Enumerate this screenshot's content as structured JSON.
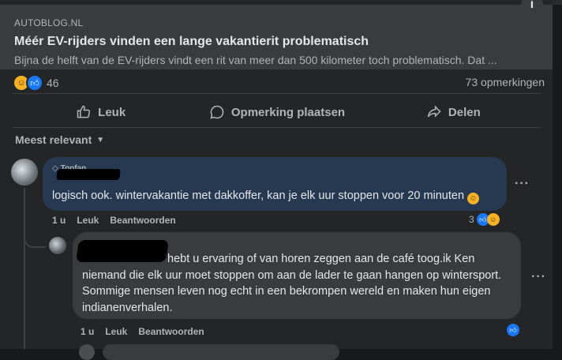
{
  "post": {
    "source": "AUTOBLOG.NL",
    "headline": "Méér EV-rijders vinden een lange vakantierit problematisch",
    "description": "Bijna de helft van de EV-rijders vindt een rit van meer dan 500 kilometer toch problematisch. Dat ...",
    "reaction_count": "46",
    "comments_count": "73 opmerkingen"
  },
  "actions": {
    "like": "Leuk",
    "comment": "Opmerking plaatsen",
    "share": "Delen"
  },
  "sort": {
    "label": "Meest relevant"
  },
  "comments": [
    {
      "badge": "Topfan",
      "text": "logisch ook. wintervakantie met dakkoffer, kan je elk uur stoppen voor 20 minuten",
      "time": "1 u",
      "like": "Leuk",
      "reply": "Beantwoorden",
      "reactions": "3"
    },
    {
      "text": "hebt u ervaring of van horen zeggen aan de café toog.ik Ken niemand die elk uur moet stoppen om aan de lader te gaan hangen op wintersport. Sommige mensen leven nog echt in een bekrompen wereld en maken hun eigen indianenverhalen.",
      "time": "1 u",
      "like": "Leuk",
      "reply": "Beantwoorden"
    }
  ],
  "icons": {
    "info": "info-icon",
    "like": "thumbs-up-icon",
    "comment": "speech-bubble-icon",
    "share": "share-arrow-icon",
    "more": "ellipsis-icon"
  },
  "colors": {
    "background": "#18191a",
    "card": "#242526",
    "accent": "#1877f2",
    "comment_bubble_topfan": "#263951",
    "comment_bubble": "#3a3b3c"
  }
}
